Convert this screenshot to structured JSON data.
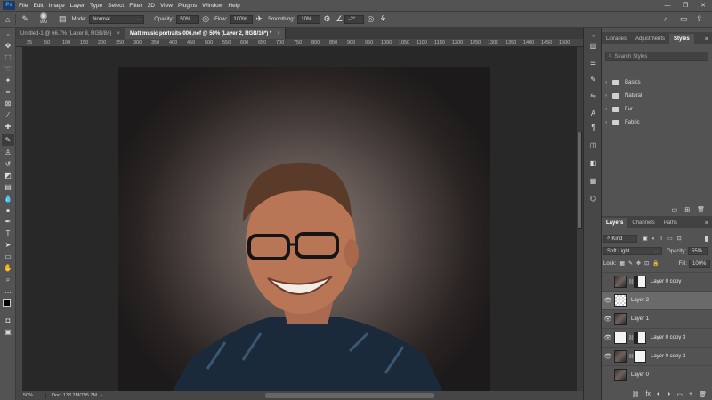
{
  "menubar": {
    "logo": "Ps",
    "items": [
      "File",
      "Edit",
      "Image",
      "Layer",
      "Type",
      "Select",
      "Filter",
      "3D",
      "View",
      "Plugins",
      "Window",
      "Help"
    ],
    "window_controls": [
      "—",
      "❐",
      "✕"
    ]
  },
  "options": {
    "brush_size": "900",
    "mode_label": "Mode:",
    "mode_value": "Normal",
    "opacity_label": "Opacity:",
    "opacity_value": "50%",
    "flow_label": "Flow:",
    "flow_value": "100%",
    "smoothing_label": "Smoothing:",
    "smoothing_value": "10%",
    "angle_value": "-2°"
  },
  "tabs": [
    {
      "label": "Untitled-1 @ 66.7% (Layer 8, RGB/8#)",
      "close": "×"
    },
    {
      "label": "Matt music portraits-006.nef @ 50% (Layer 2, RGB/16*) *",
      "close": "×"
    }
  ],
  "ruler": {
    "ticks": [
      "25",
      "50",
      "100",
      "150",
      "200",
      "250",
      "300",
      "350",
      "400",
      "450",
      "500",
      "550",
      "600",
      "650",
      "700",
      "750",
      "800",
      "850",
      "900",
      "950",
      "1000",
      "1050",
      "1100",
      "1150",
      "1200",
      "1250",
      "1300",
      "1350",
      "1400",
      "1450",
      "1500"
    ]
  },
  "status": {
    "zoom": "50%",
    "doc": "Doc: 138.2M/795.7M"
  },
  "styles_panel": {
    "tabs": [
      "Libraries",
      "Adjustments",
      "Styles"
    ],
    "search_placeholder": "Search Styles",
    "folders": [
      "Basics",
      "Natural",
      "Fur",
      "Fabric"
    ]
  },
  "layers_panel": {
    "tabs": [
      "Layers",
      "Channels",
      "Paths"
    ],
    "kind_label": "Kind",
    "blend_mode": "Soft Light",
    "opacity_label": "Opacity:",
    "opacity_value": "55%",
    "lock_label": "Lock:",
    "fill_label": "Fill:",
    "fill_value": "100%",
    "layers": [
      {
        "name": "Layer 0 copy",
        "visible": false,
        "selected": false
      },
      {
        "name": "Layer 2",
        "visible": true,
        "selected": true
      },
      {
        "name": "Layer 1",
        "visible": true,
        "selected": false
      },
      {
        "name": "Layer 0 copy 3",
        "visible": true,
        "selected": false
      },
      {
        "name": "Layer 0 copy 2",
        "visible": true,
        "selected": false
      },
      {
        "name": "Layer 0",
        "visible": false,
        "selected": false
      }
    ],
    "bottom_icons": [
      "fx",
      "◐",
      "◑",
      "▭",
      "+",
      "🗑"
    ]
  }
}
